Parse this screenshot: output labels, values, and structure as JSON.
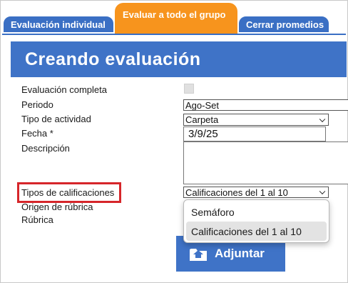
{
  "tabs": [
    {
      "label": "Evaluación individual"
    },
    {
      "label": "Evaluar a todo el grupo"
    },
    {
      "label": "Cerrar promedios"
    }
  ],
  "header": {
    "title": "Creando evaluación"
  },
  "form": {
    "completa_label": "Evaluación completa",
    "periodo_label": "Periodo",
    "periodo_value": "Ago-Set",
    "actividad_label": "Tipo de actividad",
    "actividad_value": "Carpeta",
    "fecha_label": "Fecha *",
    "fecha_value": "3/9/25",
    "descripcion_label": "Descripción",
    "tipos_label": "Tipos de calificaciones",
    "tipos_value": "Calificaciones del 1 al 10",
    "origen_label": "Origen de rúbrica",
    "rubrica_label": "Rúbrica"
  },
  "dropdown": {
    "options": [
      "Semáforo",
      "Calificaciones del 1 al 10"
    ],
    "selected_index": 1
  },
  "button": {
    "label": "Adjuntar",
    "icon": "upload-folder-icon"
  },
  "colors": {
    "tab_blue": "#3a6fc4",
    "tab_orange": "#f7941d",
    "banner_blue": "#3f73c7",
    "highlight_red": "#d6262a"
  }
}
